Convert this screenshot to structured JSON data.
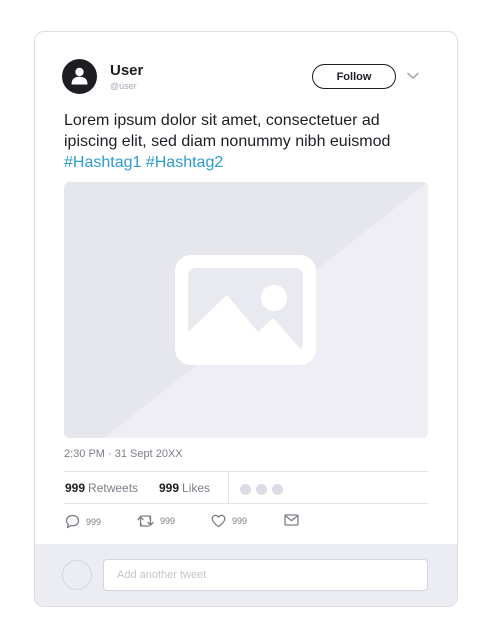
{
  "user": {
    "name": "User",
    "handle": "@user"
  },
  "follow_label": "Follow",
  "tweet": {
    "text": "Lorem ipsum dolor sit amet, consectetuer ad ipiscing elit, sed diam nonummy nibh euismod",
    "hashtags": [
      "#Hashtag1",
      "#Hashtag2"
    ]
  },
  "timestamp": "2:30 PM · 31 Sept 20XX",
  "stats": {
    "retweets_count": "999",
    "retweets_label": "Retweets",
    "likes_count": "999",
    "likes_label": "Likes"
  },
  "actions": {
    "reply_count": "999",
    "retweet_count": "999",
    "like_count": "999"
  },
  "reply_box": {
    "placeholder": "Add another tweet"
  },
  "icons": [
    "user-icon",
    "chevron-down-icon",
    "image-placeholder-icon",
    "comment-icon",
    "retweet-icon",
    "heart-icon",
    "mail-icon"
  ],
  "colors": {
    "hashtag": "#2d9bd6",
    "text": "#1d1d24",
    "muted": "#7d7d88",
    "footer_bg": "#ececf3"
  }
}
